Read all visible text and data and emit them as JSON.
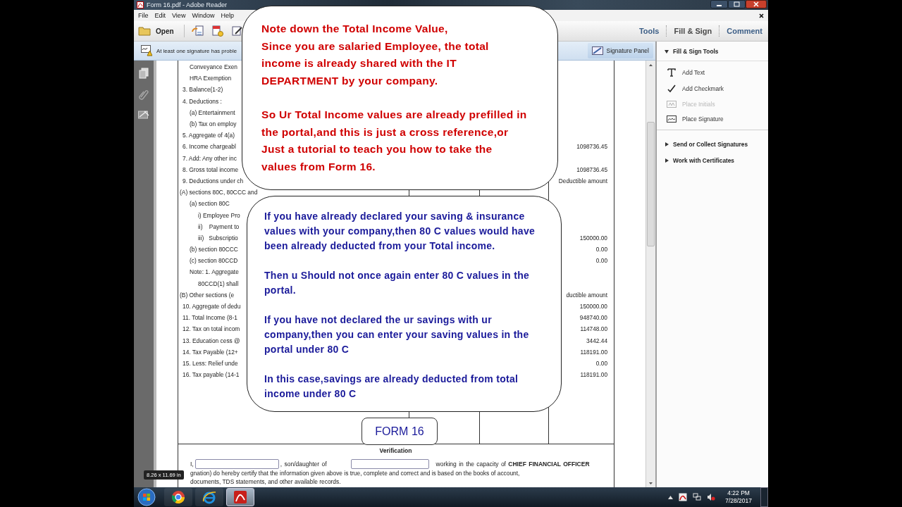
{
  "window": {
    "title": "Form 16.pdf - Adobe Reader"
  },
  "menu": [
    "File",
    "Edit",
    "View",
    "Window",
    "Help"
  ],
  "toolbar": {
    "open": "Open",
    "tabs": [
      {
        "label": "Tools",
        "selected": false
      },
      {
        "label": "Fill & Sign",
        "selected": true
      },
      {
        "label": "Comment",
        "selected": false
      }
    ]
  },
  "notification": {
    "message": "At least one signature has proble",
    "button": "Signature Panel"
  },
  "form": {
    "rows": [
      {
        "kind": "sub",
        "label": "Conveyance Exen"
      },
      {
        "kind": "sub",
        "label": "HRA Exemption"
      },
      {
        "kind": "main",
        "label": "3. Balance(1-2)"
      },
      {
        "kind": "main",
        "label": "4. Deductions :"
      },
      {
        "kind": "sub",
        "label": "(a) Entertainment"
      },
      {
        "kind": "sub",
        "label": "(b) Tax on employ"
      },
      {
        "kind": "main",
        "label": "5. Aggregate of 4(a)"
      },
      {
        "kind": "main",
        "label": "6. Income chargeabl",
        "amount": "1098736.45"
      },
      {
        "kind": "main",
        "label": "7. Add: Any other inc"
      },
      {
        "kind": "main",
        "label": "8. Gross total income",
        "amount": "1098736.45"
      },
      {
        "kind": "main",
        "label": "9. Deductions under ch",
        "amount": "Deductible amount"
      },
      {
        "kind": "section",
        "label": "(A) sections 80C, 80CCC and"
      },
      {
        "kind": "sub",
        "label": "(a) section 80C"
      },
      {
        "kind": "subsub",
        "label": "i) Employee Pro"
      },
      {
        "kind": "subsub",
        "label": "ii)    Payment to"
      },
      {
        "kind": "subsub",
        "label": "iii)   Subscriptio",
        "amount": "150000.00"
      },
      {
        "kind": "sub",
        "label": "(b) section 80CCC",
        "amount": "0.00"
      },
      {
        "kind": "sub",
        "label": "(c) section 80CCD",
        "amount": "0.00"
      },
      {
        "kind": "sub",
        "label": "Note: 1. Aggregate"
      },
      {
        "kind": "subsub",
        "label": "80CCD(1) shall"
      },
      {
        "kind": "section",
        "label": "(B) Other sections (e",
        "amount": "ductible amount"
      },
      {
        "kind": "main",
        "label": "10. Aggregate of dedu",
        "amount": "150000.00"
      },
      {
        "kind": "main",
        "label": "11. Total Income (8-1",
        "amount": "948740.00"
      },
      {
        "kind": "main",
        "label": "12. Tax on total incom",
        "amount": "114748.00"
      },
      {
        "kind": "main",
        "label": "13. Education cess @",
        "amount": "3442.44"
      },
      {
        "kind": "main",
        "label": "14. Tax Payable (12+",
        "amount": "118191.00"
      },
      {
        "kind": "main",
        "label": "15. Less: Relief unde",
        "amount": "0.00"
      },
      {
        "kind": "main",
        "label": "16. Tax payable (14-1",
        "amount": "118191.00"
      }
    ],
    "verification": "Verification",
    "declaration": {
      "prefix": "I,",
      "middle": ", son/daughter of",
      "suffix": "working  in the capacity of **CHIEF FINANCIAL OFFICER**"
    },
    "lines": [
      "gnation) do hereby certify that the information given above is true, complete and correct and is based on the books of account,",
      "documents, TDS statements, and other available records."
    ]
  },
  "page_size": "8.26 x 11.69 in",
  "panel": {
    "sections": [
      {
        "title": "Fill & Sign Tools",
        "expanded": true,
        "items": [
          {
            "kind": "text",
            "label": "Add Text",
            "disabled": false
          },
          {
            "kind": "checkmark",
            "label": "Add Checkmark",
            "disabled": false
          },
          {
            "kind": "initials",
            "label": "Place Initials",
            "disabled": true
          },
          {
            "kind": "signature",
            "label": "Place Signature",
            "disabled": false
          }
        ]
      },
      {
        "title": "Send or Collect Signatures",
        "expanded": false
      },
      {
        "title": "Work with Certificates",
        "expanded": false
      }
    ]
  },
  "callouts": [
    {
      "color": "#d00000",
      "paragraphs": [
        [
          "Note down the Total Income Value,",
          "Since you are salaried Employee, the total income is already shared with the IT DEPARTMENT by your company."
        ],
        [
          "So Ur Total Income values are already prefilled in the portal,and this is just a cross reference,or Just a tutorial to teach you how to take the values from Form 16."
        ]
      ]
    },
    {
      "color": "#1a1a9a",
      "paragraphs": [
        [
          "If you have already declared your saving & insurance values with your company,then 80 C values would have been already deducted from your Total income."
        ],
        [
          "Then u Should not once again enter 80 C values in the portal."
        ],
        [
          "If you have not declared the ur savings with ur company,then you can enter your saving values in the portal under 80 C"
        ],
        [
          "In this case,savings are already deducted from total income under 80 C"
        ]
      ]
    }
  ],
  "stamp": "FORM 16",
  "taskbar": {
    "apps": [
      {
        "kind": "chrome",
        "selected": false
      },
      {
        "kind": "ie",
        "selected": false
      },
      {
        "kind": "acrobat",
        "selected": true
      }
    ],
    "time": "4:22 PM",
    "date": "7/28/2017"
  }
}
